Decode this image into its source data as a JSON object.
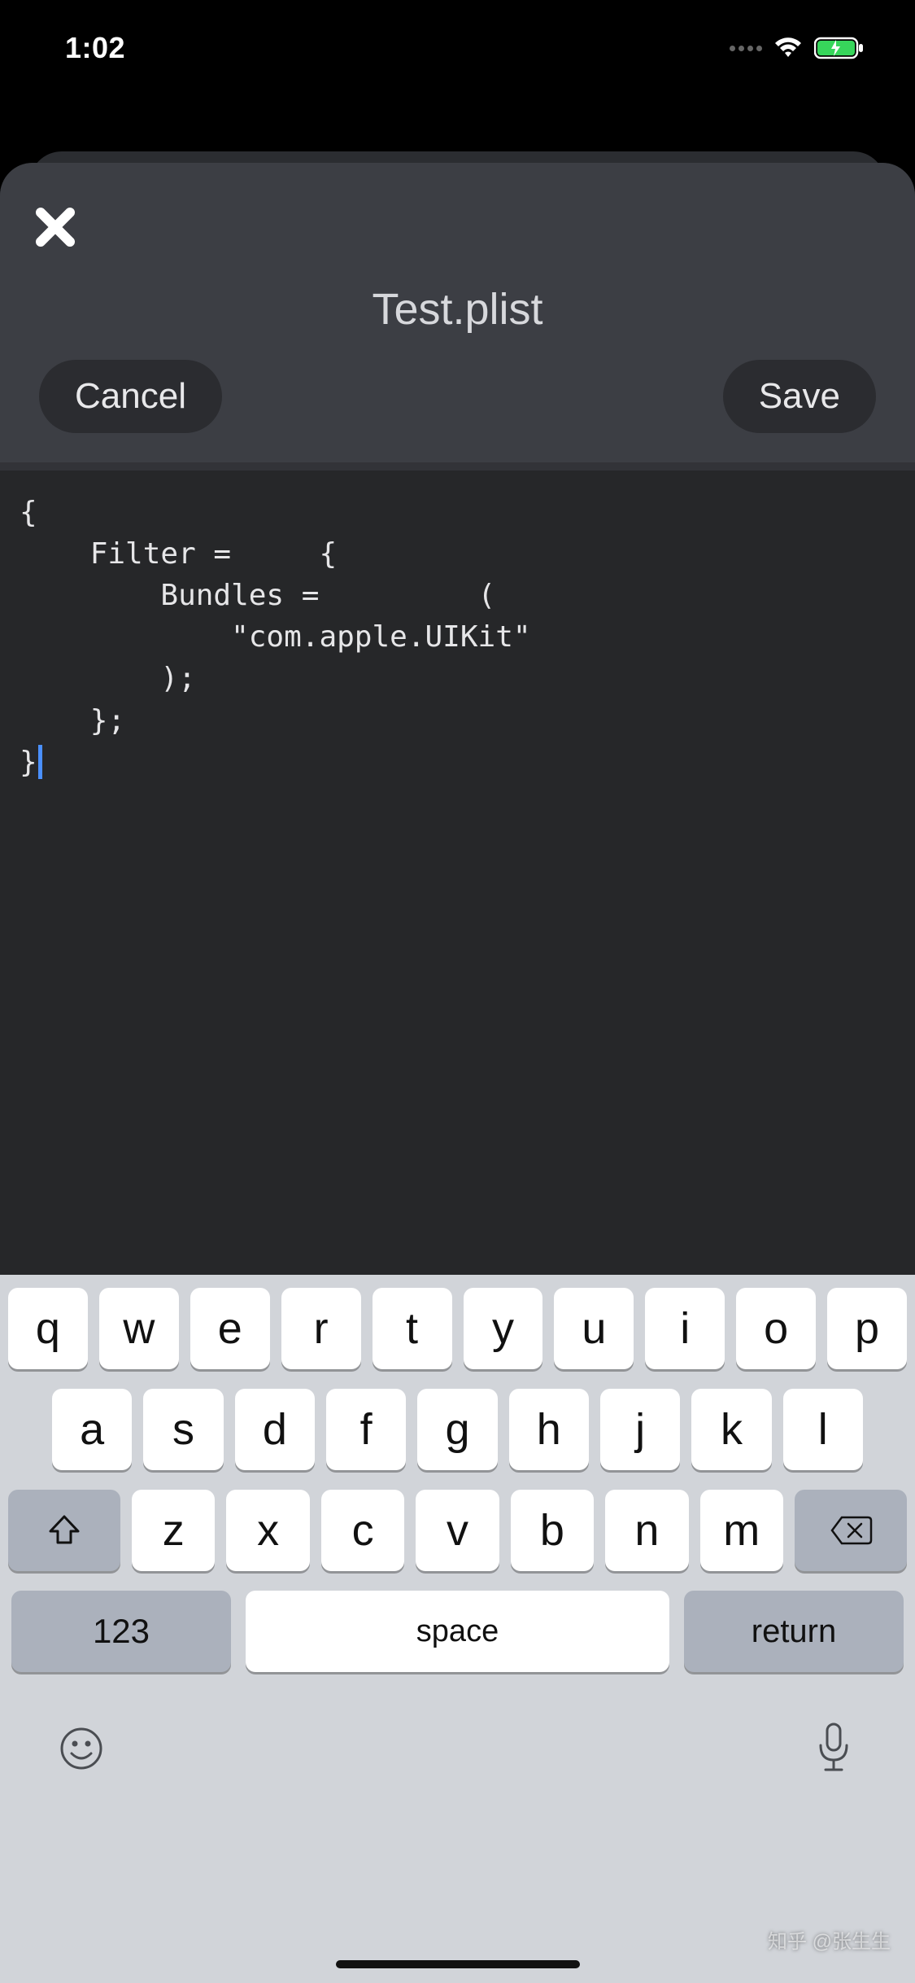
{
  "status": {
    "time": "1:02"
  },
  "header": {
    "title": "Test.plist",
    "cancel_label": "Cancel",
    "save_label": "Save"
  },
  "editor": {
    "content": "{\n    Filter =     {\n        Bundles =         (\n            \"com.apple.UIKit\"\n        );\n    };\n}"
  },
  "keyboard": {
    "row1": [
      "q",
      "w",
      "e",
      "r",
      "t",
      "y",
      "u",
      "i",
      "o",
      "p"
    ],
    "row2": [
      "a",
      "s",
      "d",
      "f",
      "g",
      "h",
      "j",
      "k",
      "l"
    ],
    "row3": [
      "z",
      "x",
      "c",
      "v",
      "b",
      "n",
      "m"
    ],
    "num_label": "123",
    "space_label": "space",
    "return_label": "return"
  },
  "watermark": "知乎 @张生生"
}
